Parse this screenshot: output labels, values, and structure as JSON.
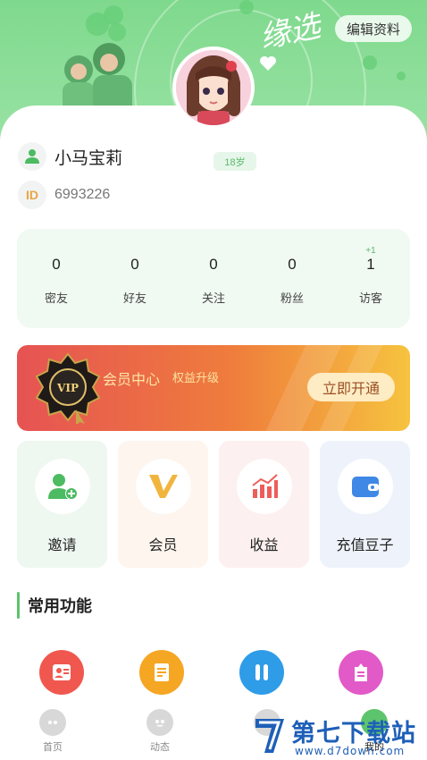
{
  "header": {
    "edit_label": "编辑资料",
    "deco_text": "缘选"
  },
  "profile": {
    "name": "小马宝莉",
    "age": "18岁",
    "id_label": "ID",
    "id_value": "6993226"
  },
  "stats": [
    {
      "value": "0",
      "label": "密友"
    },
    {
      "value": "0",
      "label": "好友"
    },
    {
      "value": "0",
      "label": "关注"
    },
    {
      "value": "0",
      "label": "粉丝"
    },
    {
      "value": "1",
      "label": "访客",
      "delta": "+1"
    }
  ],
  "vip": {
    "title": "会员中心",
    "subtitle": "权益升级",
    "button": "立即开通",
    "medal_text": "VIP"
  },
  "tiles": [
    {
      "label": "邀请",
      "icon": "add-user-icon",
      "bg": "#eef7f0"
    },
    {
      "label": "会员",
      "icon": "vip-v-icon",
      "bg": "#fdf5ee"
    },
    {
      "label": "收益",
      "icon": "chart-icon",
      "bg": "#fdf0f0"
    },
    {
      "label": "充值豆子",
      "icon": "wallet-icon",
      "bg": "#eef3fb"
    }
  ],
  "section": {
    "title": "常用功能"
  },
  "functions": [
    {
      "icon": "id-card-icon",
      "color": "#f0584f"
    },
    {
      "icon": "document-icon",
      "color": "#f5a623"
    },
    {
      "icon": "tools-icon",
      "color": "#2f9ce8"
    },
    {
      "icon": "badge-icon",
      "color": "#e15ac8"
    }
  ],
  "tabbar": {
    "items": [
      {
        "label": "首页",
        "icon": "home-icon"
      },
      {
        "label": "动态",
        "icon": "moments-icon"
      },
      {
        "label": "",
        "icon": "message-icon"
      },
      {
        "label": "我的",
        "icon": "profile-icon"
      }
    ]
  },
  "watermark": {
    "title": "第七下载站",
    "url": "www.d7down.com"
  },
  "colors": {
    "accent": "#5cc46c",
    "hero": "#7fd98d",
    "vip_start": "#e65353",
    "vip_end": "#f6c33f"
  }
}
